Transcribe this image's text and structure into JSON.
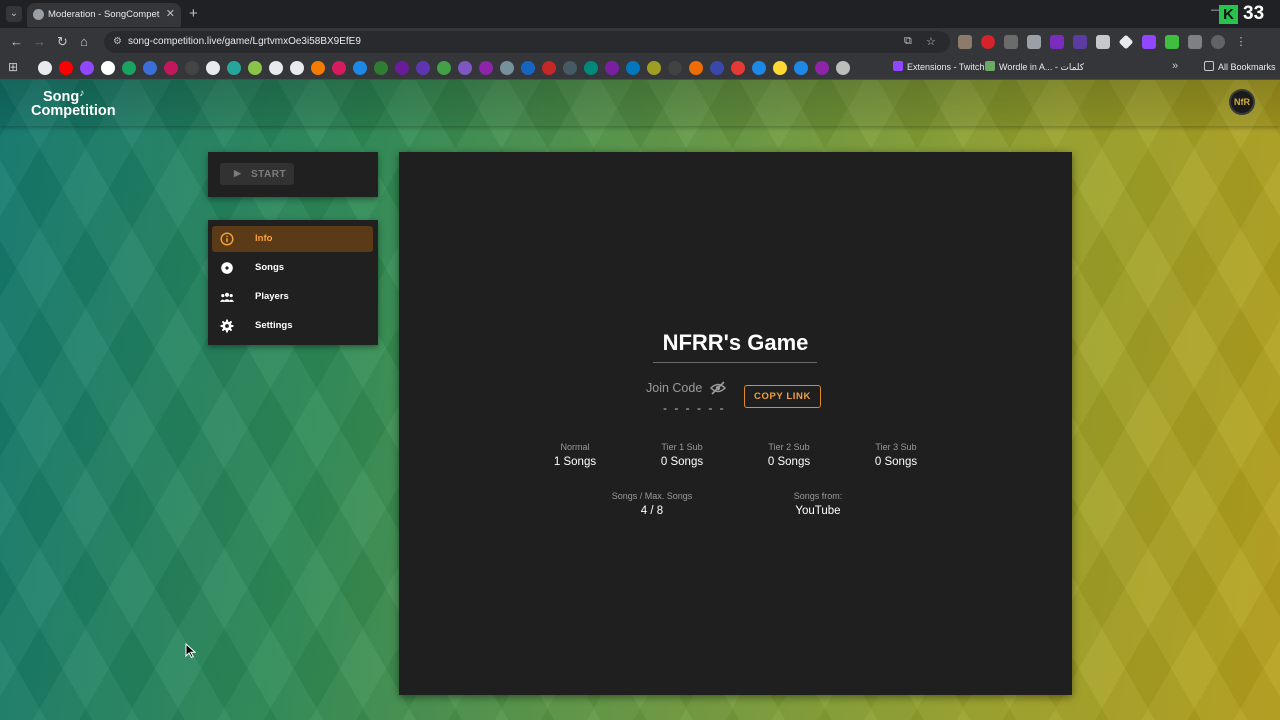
{
  "browser": {
    "tab_title": "Moderation - SongCompetition",
    "tab_close": "✕",
    "new_tab": "+",
    "url": "song-competition.live/game/LgrtvmxOe3i58BX9EfE9",
    "window_controls": "—",
    "counter": "33",
    "k_logo": "K",
    "bookmarks": {
      "extensions_twitch": "Extensions - Twitch",
      "wordle": "Wordle in A... - كلمات",
      "all_bookmarks": "All Bookmarks"
    }
  },
  "app": {
    "logo_line1": "Song",
    "logo_line2": "Competition",
    "avatar_initials": "NfR",
    "start_label": "START",
    "menu": [
      {
        "label": "Info",
        "icon": "info-icon",
        "active": true
      },
      {
        "label": "Songs",
        "icon": "disc-icon",
        "active": false
      },
      {
        "label": "Players",
        "icon": "players-icon",
        "active": false
      },
      {
        "label": "Settings",
        "icon": "gear-icon",
        "active": false
      }
    ],
    "main": {
      "title": "NFRR's Game",
      "join_label": "Join Code",
      "join_code": "- - - - - -",
      "copy_link": "COPY LINK",
      "tiers": [
        {
          "label": "Normal",
          "value": "1 Songs"
        },
        {
          "label": "Tier 1 Sub",
          "value": "0 Songs"
        },
        {
          "label": "Tier 2 Sub",
          "value": "0 Songs"
        },
        {
          "label": "Tier 3 Sub",
          "value": "0 Songs"
        }
      ],
      "songs_max_label": "Songs / Max. Songs",
      "songs_max_value": "4 / 8",
      "songs_from_label": "Songs from:",
      "songs_from_value": "YouTube"
    },
    "accent_color": "#f0a040"
  }
}
